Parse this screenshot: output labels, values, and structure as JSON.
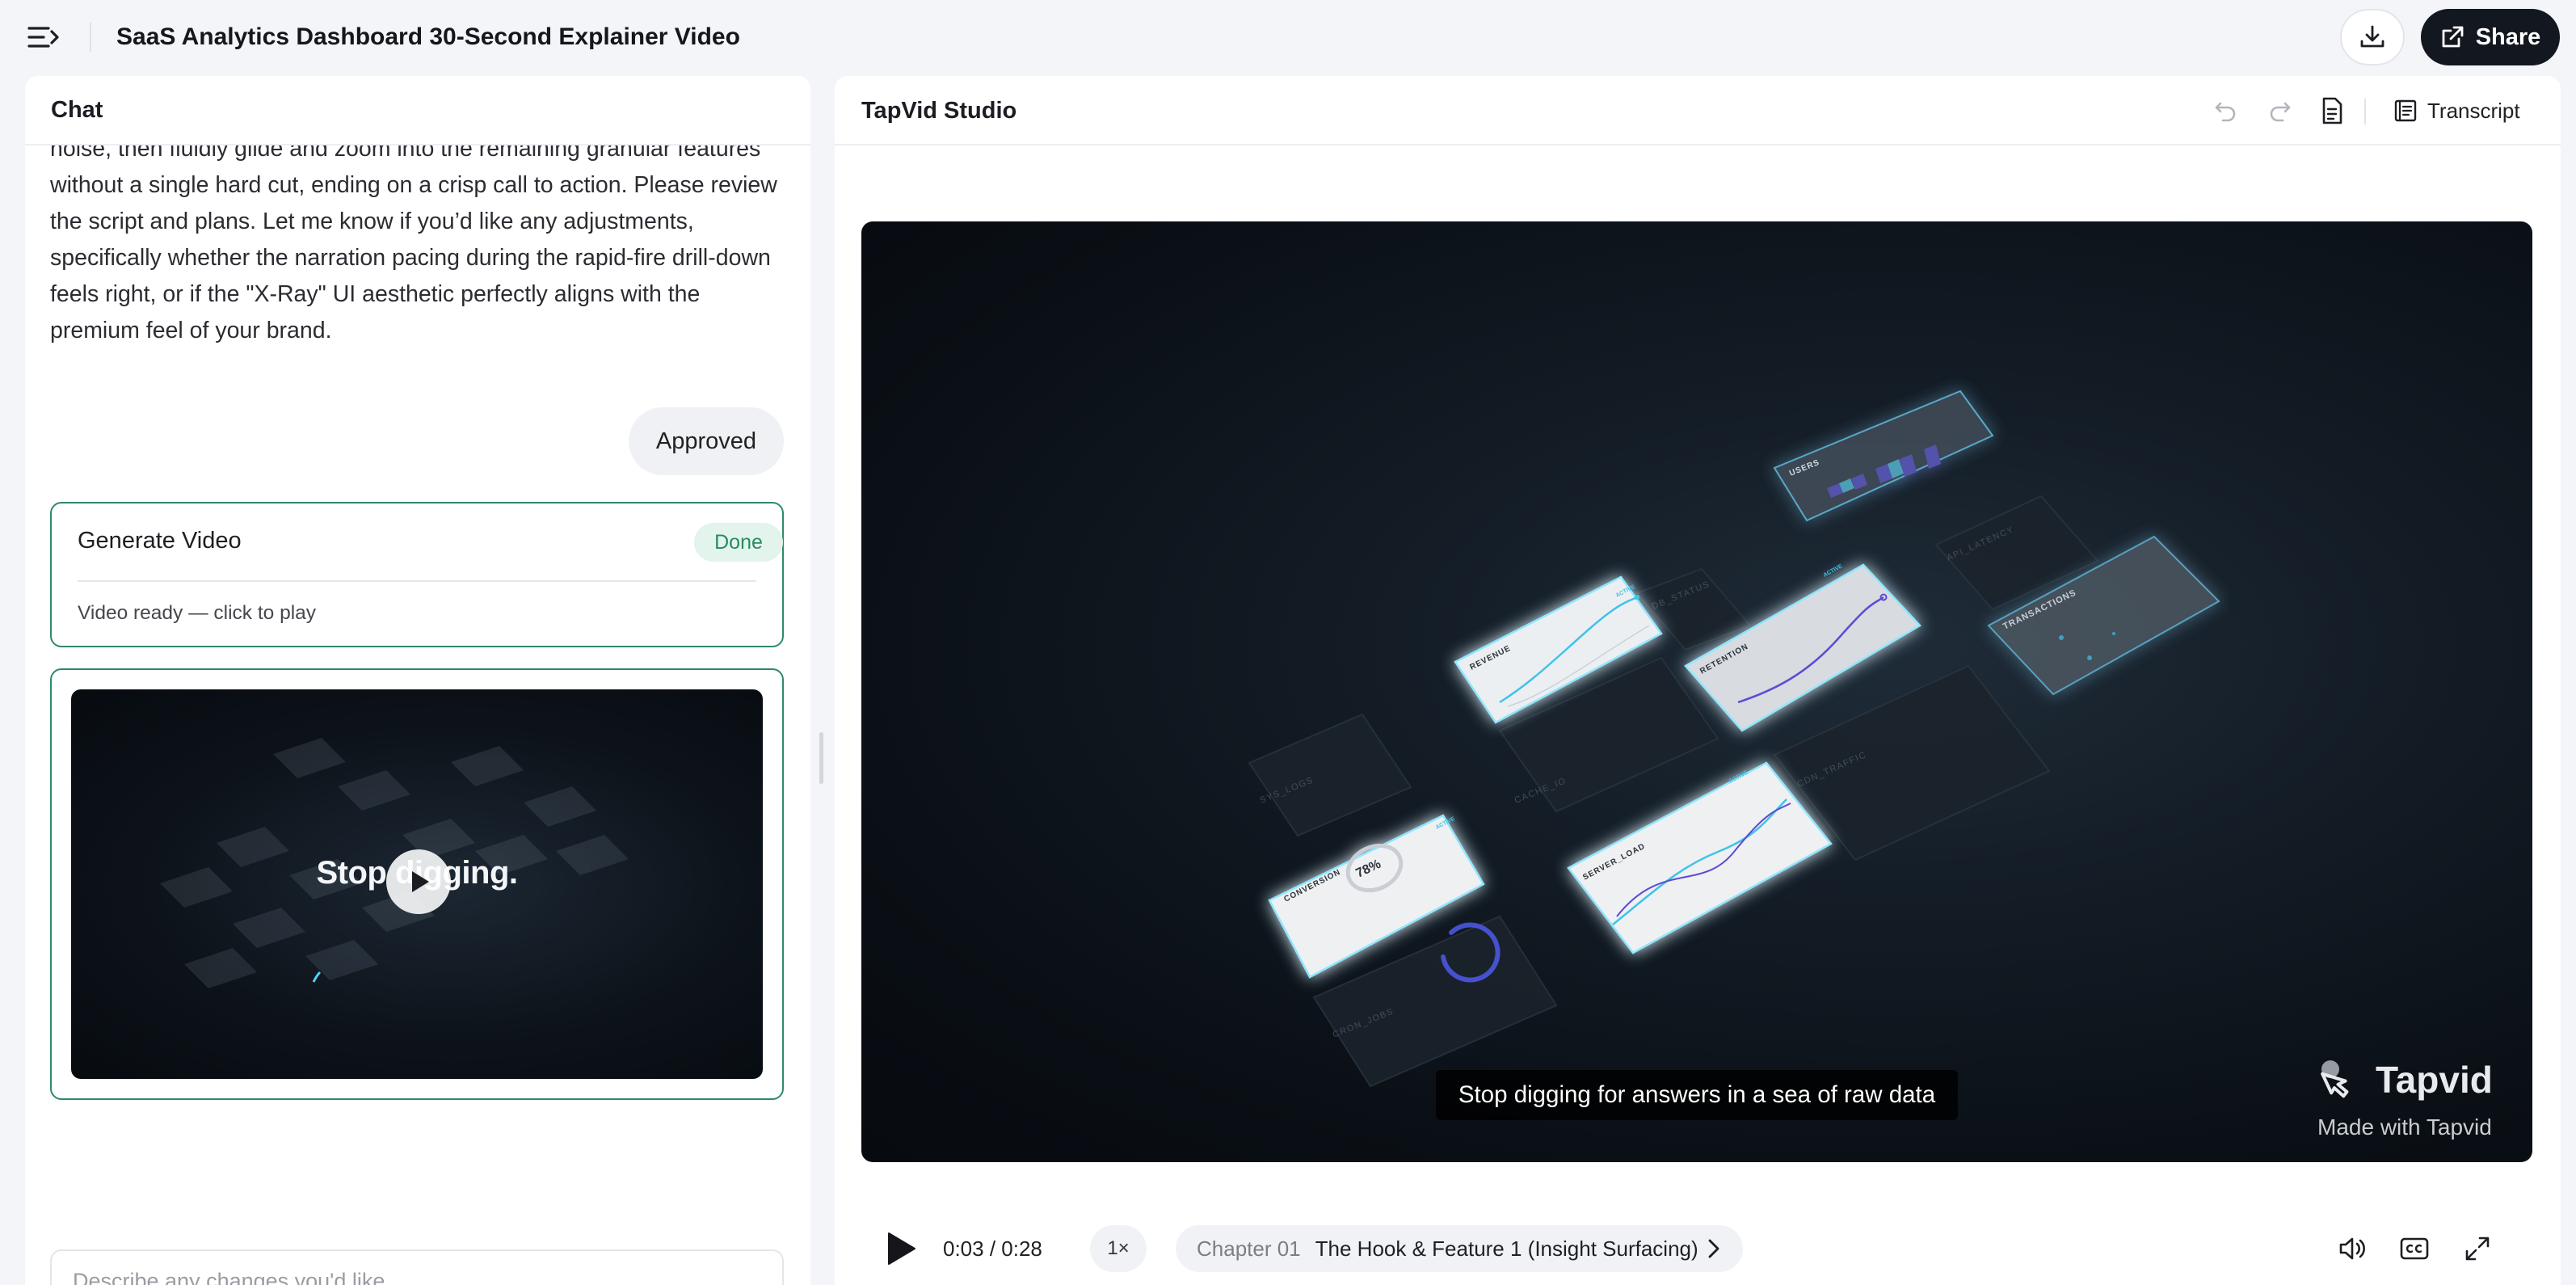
{
  "header": {
    "title": "SaaS Analytics Dashboard 30-Second Explainer Video",
    "share_label": "Share"
  },
  "chat": {
    "header": "Chat",
    "message": "noise, then fluidly glide and zoom into the remaining granular features without a single hard cut, ending on a crisp call to action. Please review the script and plans. Let me know if you’d like any adjustments, specifically whether the narration pacing during the rapid-fire drill-down feels right, or if the \"X-Ray\" UI aesthetic perfectly aligns with the premium feel of your brand.",
    "user_reply": "Approved",
    "task": {
      "title": "Generate Video",
      "status": "Done",
      "detail": "Video ready — click to play"
    },
    "thumbnail_text": "Stop digging.",
    "input_placeholder": "Describe any changes you'd like..."
  },
  "studio": {
    "title": "TapVid Studio",
    "transcript_label": "Transcript",
    "video": {
      "caption": "Stop digging for answers in a sea of raw data",
      "brand_name": "Tapvid",
      "brand_sub": "Made with Tapvid",
      "cards": {
        "users": "USERS",
        "revenue": "REVENUE",
        "retention": "RETENTION",
        "transactions": "TRANSACTIONS",
        "conversion": "CONVERSION",
        "conversion_value": "78%",
        "server_load": "SERVER_LOAD",
        "active": "ACTIVE",
        "db_status": "DB_STATUS",
        "api_latency": "API_LATENCY",
        "sys_logs": "SYS_LOGS",
        "cache_io": "CACHE_IO",
        "cdn_traffic": "CDN_TRAFFIC",
        "cron_jobs": "CRON_JOBS"
      }
    },
    "controls": {
      "time": "0:03 / 0:28",
      "speed": "1×",
      "chapter_number": "Chapter 01",
      "chapter_name": "The Hook & Feature 1 (Insight Surfacing)"
    }
  },
  "colors": {
    "accent_green": "#2f8a66",
    "share_bg": "#13171f",
    "video_bg": "#0a0f15",
    "glow": "#7fe3ff"
  }
}
